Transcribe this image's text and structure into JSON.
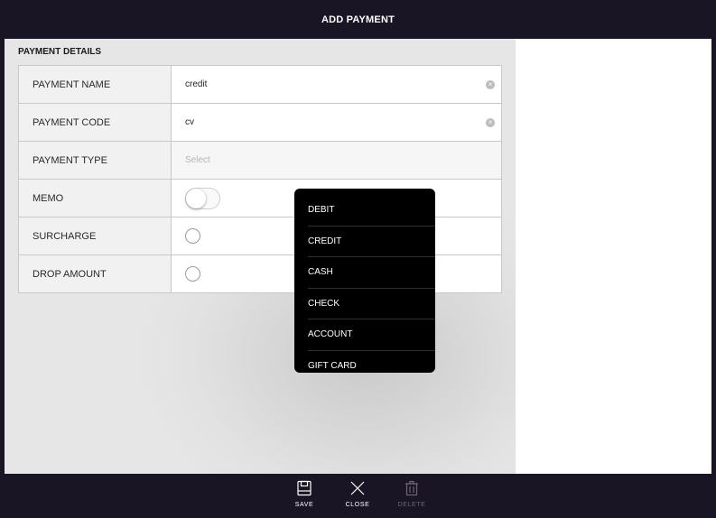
{
  "header": {
    "title": "ADD PAYMENT"
  },
  "section": {
    "title": "PAYMENT DETAILS"
  },
  "form": {
    "payment_name": {
      "label": "PAYMENT NAME",
      "value": "credit"
    },
    "payment_code": {
      "label": "PAYMENT CODE",
      "value": "cv"
    },
    "payment_type": {
      "label": "PAYMENT TYPE",
      "placeholder": "Select"
    },
    "memo": {
      "label": "MEMO",
      "enabled": false
    },
    "surcharge": {
      "label": "SURCHARGE",
      "checked": false
    },
    "drop_amount": {
      "label": "DROP AMOUNT",
      "checked": false
    }
  },
  "dropdown": {
    "options": [
      "DEBIT",
      "CREDIT",
      "CASH",
      "CHECK",
      "ACCOUNT",
      "GIFT CARD"
    ]
  },
  "toolbar": {
    "save": {
      "label": "SAVE",
      "icon": "save-icon"
    },
    "close": {
      "label": "CLOSE",
      "icon": "close-icon"
    },
    "delete": {
      "label": "DELETE",
      "icon": "trash-icon",
      "disabled": true
    }
  },
  "colors": {
    "chrome": "#1a1525",
    "dropdown": "#000000",
    "disabled_label": "#6b6775"
  }
}
